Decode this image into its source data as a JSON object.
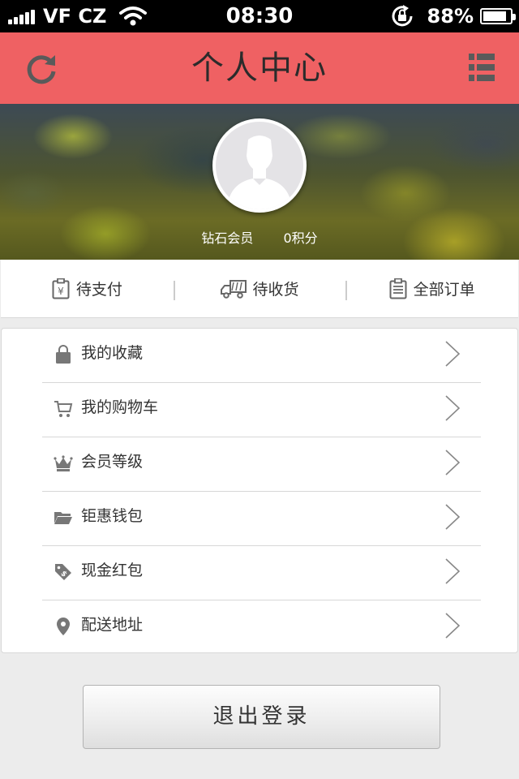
{
  "status_bar": {
    "carrier": "VF CZ",
    "time": "08:30",
    "battery_percent": "88%",
    "battery_level": 0.88,
    "icons": [
      "signal-icon",
      "wifi-icon",
      "rotation-lock-icon",
      "battery-icon"
    ]
  },
  "header": {
    "title": "个人中心",
    "background_color": "#ef6163",
    "left_icon": "refresh-icon",
    "right_icon": "menu-list-icon"
  },
  "profile": {
    "member_level": "钻石会员",
    "points": "0积分",
    "avatar_icon": "default-avatar-icon"
  },
  "orders": [
    {
      "label": "待支付",
      "icon": "payment-icon"
    },
    {
      "label": "待收货",
      "icon": "truck-icon"
    },
    {
      "label": "全部订单",
      "icon": "clipboard-icon"
    }
  ],
  "menu": [
    {
      "label": "我的收藏",
      "icon": "bag-icon"
    },
    {
      "label": "我的购物车",
      "icon": "cart-icon"
    },
    {
      "label": "会员等级",
      "icon": "crown-icon"
    },
    {
      "label": "钜惠钱包",
      "icon": "folder-icon"
    },
    {
      "label": "现金红包",
      "icon": "price-tag-icon"
    },
    {
      "label": "配送地址",
      "icon": "location-pin-icon"
    }
  ],
  "logout": {
    "label": "退出登录"
  }
}
